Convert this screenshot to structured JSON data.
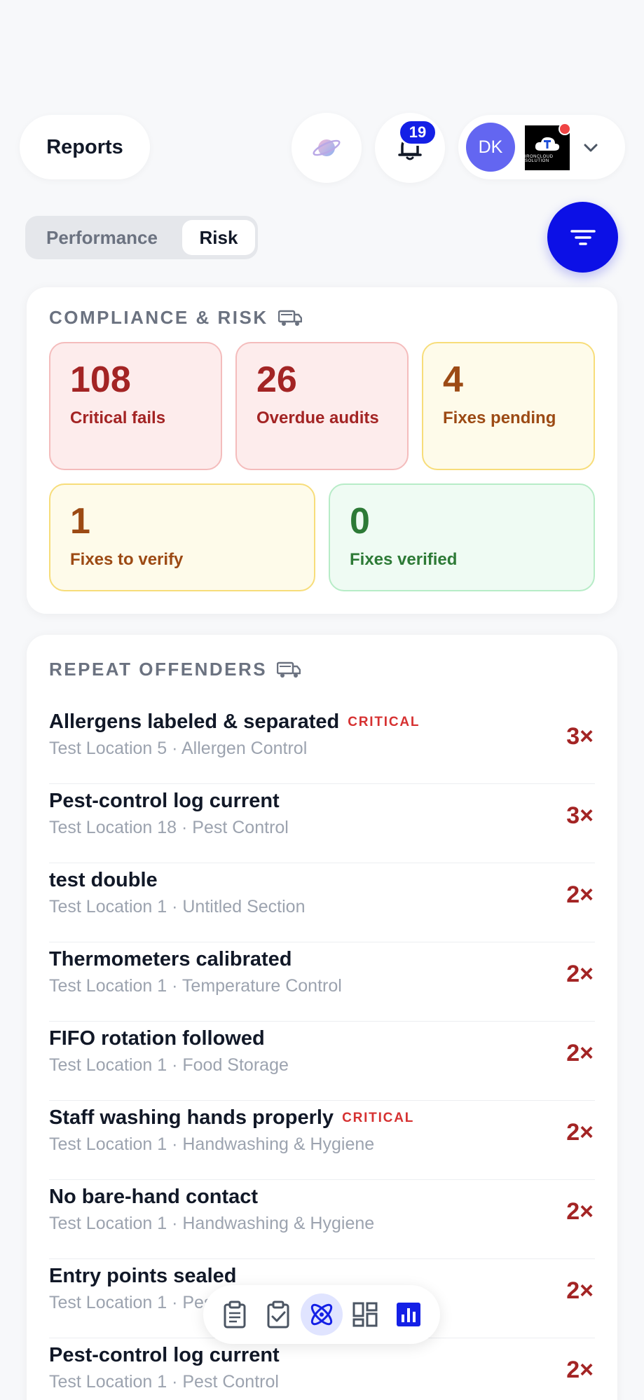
{
  "header": {
    "title": "Reports",
    "notifications_count": "19",
    "avatar_initials": "DK",
    "org_logo_text": "IRONCLOUD SOLUTION"
  },
  "tabs": [
    {
      "label": "Performance",
      "active": false
    },
    {
      "label": "Risk",
      "active": true
    }
  ],
  "compliance": {
    "title": "COMPLIANCE & RISK",
    "stats": [
      {
        "value": "108",
        "label": "Critical fails",
        "tone": "red"
      },
      {
        "value": "26",
        "label": "Overdue audits",
        "tone": "red"
      },
      {
        "value": "4",
        "label": "Fixes pending",
        "tone": "yellow"
      },
      {
        "value": "1",
        "label": "Fixes to verify",
        "tone": "yellow"
      },
      {
        "value": "0",
        "label": "Fixes verified",
        "tone": "green"
      }
    ]
  },
  "offenders": {
    "title": "REPEAT OFFENDERS",
    "critical_label": "CRITICAL",
    "items": [
      {
        "title": "Allergens labeled & separated",
        "critical": true,
        "location": "Test Location 5 · Allergen Control",
        "count": "3×"
      },
      {
        "title": "Pest-control log current",
        "critical": false,
        "location": "Test Location 18 · Pest Control",
        "count": "3×"
      },
      {
        "title": "test double",
        "critical": false,
        "location": "Test Location 1 · Untitled Section",
        "count": "2×"
      },
      {
        "title": "Thermometers calibrated",
        "critical": false,
        "location": "Test Location 1 · Temperature Control",
        "count": "2×"
      },
      {
        "title": "FIFO rotation followed",
        "critical": false,
        "location": "Test Location 1 · Food Storage",
        "count": "2×"
      },
      {
        "title": "Staff washing hands properly",
        "critical": true,
        "location": "Test Location 1 · Handwashing & Hygiene",
        "count": "2×"
      },
      {
        "title": "No bare-hand contact",
        "critical": false,
        "location": "Test Location 1 · Handwashing & Hygiene",
        "count": "2×"
      },
      {
        "title": "Entry points sealed",
        "critical": false,
        "location": "Test Location 1 · Pest Control",
        "count": "2×"
      },
      {
        "title": "Pest-control log current",
        "critical": false,
        "location": "Test Location 1 · Pest Control",
        "count": "2×"
      }
    ]
  },
  "bottom_nav": [
    {
      "icon": "clipboard-icon",
      "active": false
    },
    {
      "icon": "clipboard-check-icon",
      "active": false
    },
    {
      "icon": "atom-icon",
      "active": true
    },
    {
      "icon": "dashboard-icon",
      "active": false
    },
    {
      "icon": "bar-chart-icon",
      "active": false
    }
  ],
  "colors": {
    "accent": "#0c10e6",
    "critical": "#a32424",
    "warning": "#9c4a14",
    "success": "#2d7a36"
  }
}
